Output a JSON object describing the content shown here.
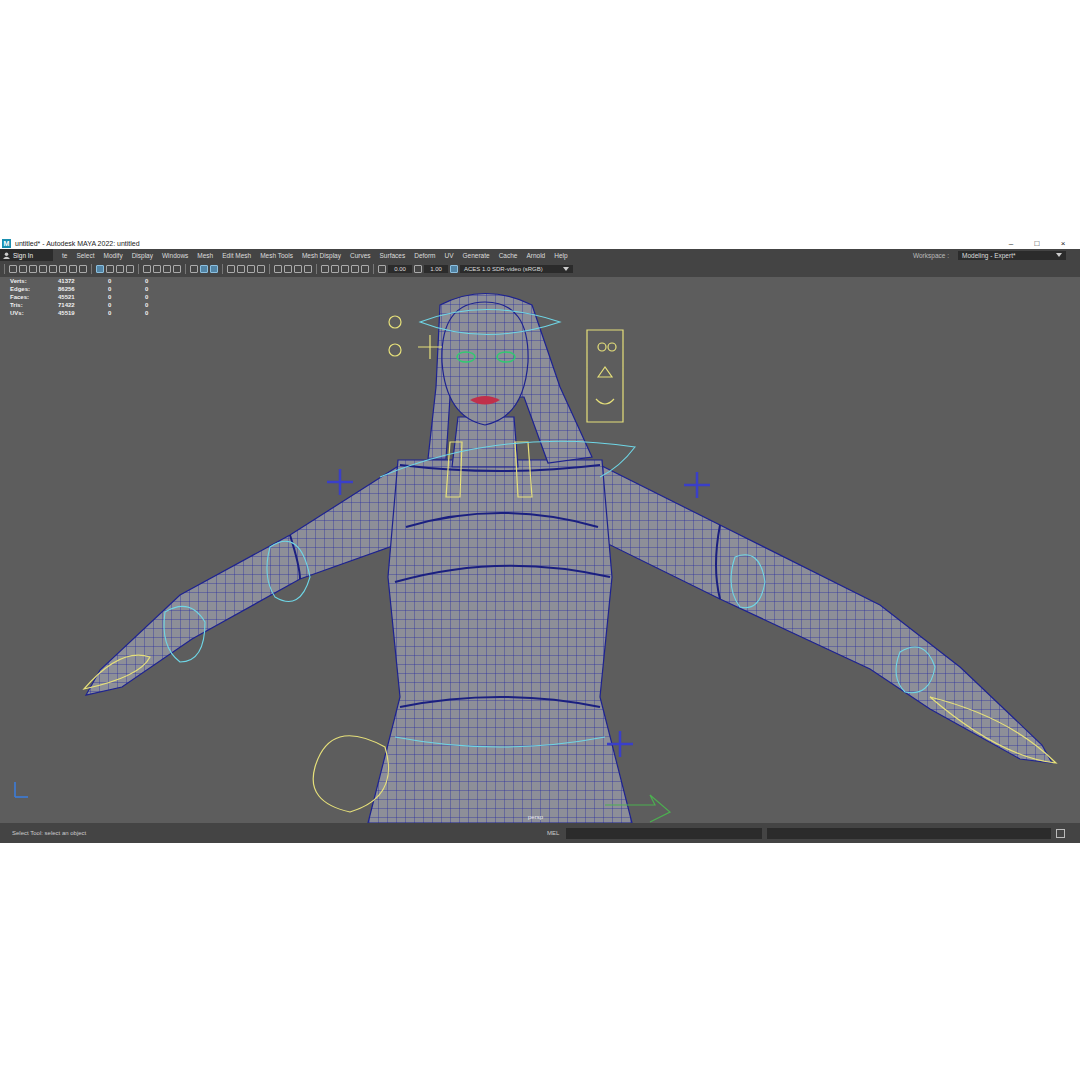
{
  "window": {
    "title": "untitled* - Autodesk MAYA 2022: untitled",
    "logo": "M",
    "controls": [
      "–",
      "□",
      "×"
    ]
  },
  "sign_in": {
    "label": "Sign In"
  },
  "menu": {
    "items": [
      "te",
      "Select",
      "Modify",
      "Display",
      "Windows",
      "Mesh",
      "Edit Mesh",
      "Mesh Tools",
      "Mesh Display",
      "Curves",
      "Surfaces",
      "Deform",
      "UV",
      "Generate",
      "Cache",
      "Arnold",
      "Help"
    ]
  },
  "workspace": {
    "label": "Workspace :",
    "value": "Modeling - Expert*"
  },
  "toolbar": {
    "groups": [
      [
        {
          "on": false
        },
        {
          "on": false
        },
        {
          "on": false
        },
        {
          "on": false
        },
        {
          "on": false
        },
        {
          "on": false
        },
        {
          "on": false
        },
        {
          "on": false
        }
      ],
      [
        {
          "on": true
        },
        {
          "on": false
        },
        {
          "on": false
        },
        {
          "on": false
        }
      ],
      [
        {
          "on": false
        },
        {
          "on": false
        },
        {
          "on": false
        },
        {
          "on": false
        }
      ],
      [
        {
          "on": false
        },
        {
          "on": true
        },
        {
          "on": true
        }
      ],
      [
        {
          "on": false
        },
        {
          "on": false
        },
        {
          "on": false
        },
        {
          "on": false
        }
      ],
      [
        {
          "on": false
        },
        {
          "on": false
        },
        {
          "on": false
        },
        {
          "on": false
        }
      ],
      [
        {
          "on": false
        },
        {
          "on": false
        },
        {
          "on": false
        },
        {
          "on": false
        },
        {
          "on": false
        }
      ]
    ],
    "exposure": "0.00",
    "gamma": "1.00",
    "color_space": "ACES 1.0 SDR-video (sRGB)"
  },
  "hud": {
    "rows": [
      {
        "label": "Verts:",
        "values": [
          "41372",
          "0",
          "0"
        ]
      },
      {
        "label": "Edges:",
        "values": [
          "86256",
          "0",
          "0"
        ]
      },
      {
        "label": "Faces:",
        "values": [
          "45521",
          "0",
          "0"
        ]
      },
      {
        "label": "Tris:",
        "values": [
          "71422",
          "0",
          "0"
        ]
      },
      {
        "label": "UVs:",
        "values": [
          "45519",
          "0",
          "0"
        ]
      }
    ]
  },
  "viewport": {
    "camera": "persp"
  },
  "status_bar": {
    "help": "Select Tool: select an object",
    "command_language": "MEL"
  }
}
